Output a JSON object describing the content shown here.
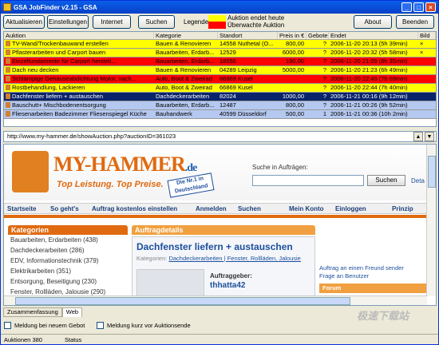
{
  "window": {
    "title": "GSA JobFinder v2.15 - GSA"
  },
  "toolbar": {
    "aktualisieren": "Aktualisieren",
    "einstellungen": "Einstellungen",
    "internet": "Internet",
    "suchen": "Suchen",
    "legende": "Legende",
    "legend_yellow": "Auktion endet heute",
    "legend_red": "Überwachte Auktion",
    "about": "About",
    "beenden": "Beenden"
  },
  "grid": {
    "headers": [
      "Auktion",
      "Kategorie",
      "Standort",
      "Preis in €",
      "Gebote",
      "Endet",
      "Bild"
    ],
    "rows": [
      {
        "auktion": "TV-Wand/Trockenbauwand erstellen",
        "kategorie": "Bauen & Renovieren",
        "standort": "14558 Nuthetal (O...",
        "preis": "800,00",
        "gebote": "?",
        "endet": "2006-11-20 20:13 (5h 39min)",
        "bild": "×",
        "color": "#ffff00",
        "fg": "#000"
      },
      {
        "auktion": "Pflasterarbeiten und Carport bauen",
        "kategorie": "Bauarbeiten, Erdarb...",
        "standort": "12529",
        "preis": "6000,00",
        "gebote": "?",
        "endet": "2006-11-20 20:32 (5h 58min)",
        "bild": "×",
        "color": "#ffff00",
        "fg": "#000"
      },
      {
        "auktion": "Einzelfundamente für Carport herstell...",
        "kategorie": "Bauarbeiten, Erdarb...",
        "standort": "18556",
        "preis": "190,00",
        "gebote": "?",
        "endet": "2006-11-20 21:09 (6h 35min)",
        "bild": "",
        "color": "#ff0000",
        "fg": "#000"
      },
      {
        "auktion": "Dach neu decken",
        "kategorie": "Bauen & Renovieren",
        "standort": "04289 Leipzig",
        "preis": "5000,00",
        "gebote": "?",
        "endet": "2006-11-20 21:23 (6h 49min)",
        "bild": "",
        "color": "#ffff00",
        "fg": "#000"
      },
      {
        "auktion": "Schlämpige Gehäuseabdichtung Motor, nach...",
        "kategorie": "Auto, Boot & Zweirad",
        "standort": "66869 Kusel",
        "preis": "",
        "gebote": "?",
        "endet": "2006-11-20 22:43 (7h 69min)",
        "bild": "",
        "color": "#ff0000",
        "fg": "#000"
      },
      {
        "auktion": "Rostbehandlung, Lackieren",
        "kategorie": "Auto, Boot & Zweirad",
        "standort": "66869 Kusel",
        "preis": "",
        "gebote": "?",
        "endet": "2006-11-20 22:44 (7h 40min)",
        "bild": "",
        "color": "#ffff00",
        "fg": "#000"
      },
      {
        "auktion": "Dachfenster liefern + austauschen",
        "kategorie": "Dachdeckerarbeiten",
        "standort": "82024",
        "preis": "1000,00",
        "gebote": "?",
        "endet": "2006-11-21 00:16 (9h 12min)",
        "bild": "",
        "color": "#0a246a",
        "fg": "#fff"
      },
      {
        "auktion": "Bauschutt+ Mischbodenentsorgung",
        "kategorie": "Bauarbeiten, Erdarb...",
        "standort": "12487",
        "preis": "800,00",
        "gebote": "?",
        "endet": "2006-11-21 00:26 (9h 52min)",
        "bild": "",
        "color": "#b4c8f0",
        "fg": "#000"
      },
      {
        "auktion": "Fliesenarbeiten Badezimmer Fliesenspiegel Küche",
        "kategorie": "Bauhandwerk",
        "standort": "40599 Düsseldorf",
        "preis": "500,00",
        "gebote": "1",
        "endet": "2006-11-21 00:36 (10h 2min)",
        "bild": "",
        "color": "#b4c8f0",
        "fg": "#000"
      }
    ]
  },
  "browser": {
    "url": "http://www.my-hammer.de/showAuction.php?auctionID=361023",
    "logo": "MY-HAMMER",
    "logo_de": ".de",
    "tagline": "Top Leistung. Top Preise.",
    "badge": "Die Nr.1 in Deutschland",
    "search_label": "Suche in Aufträgen:",
    "search_button": "Suchen",
    "search_right": "Deta",
    "nav": [
      "Startseite",
      "So geht's",
      "Auftrag kostenlos einstellen",
      "Anmelden",
      "Suchen",
      "Mein Konto",
      "Einloggen",
      "Prinzip"
    ],
    "kategorien_title": "Kategorien",
    "kategorien": [
      "Bauarbeiten, Erdarbeiten (438)",
      "Dachdeckerarbeiten (286)",
      "EDV, Informationstechnik (379)",
      "Elektrikarbeiten (351)",
      "Entsorgung, Beseitigung (230)",
      "Fenster, Rollläden, Jalousie (290)"
    ],
    "details_title": "Auftragdetails",
    "auction_title": "Dachfenster liefern + austauschen",
    "categories_label": "Kategorien:",
    "categories_links": "Dachdeckerarbeiten | Fenster, Rollläden, Jalousie",
    "auftraggeber_label": "Auftraggeber:",
    "auftraggeber_user": "thhatta42",
    "side_links": [
      "Auftrag an einen Freund sender",
      "Frage an Benutzer"
    ],
    "forum": "Forum"
  },
  "tabs": [
    "Zusammenfassung",
    "Web"
  ],
  "checkboxes": [
    "Meldung bei neuem Gebot",
    "Meldung kurz vor Auktionsende"
  ],
  "status": {
    "count": "Auktionen 380",
    "status": "Status"
  },
  "watermark": "极速下载站"
}
